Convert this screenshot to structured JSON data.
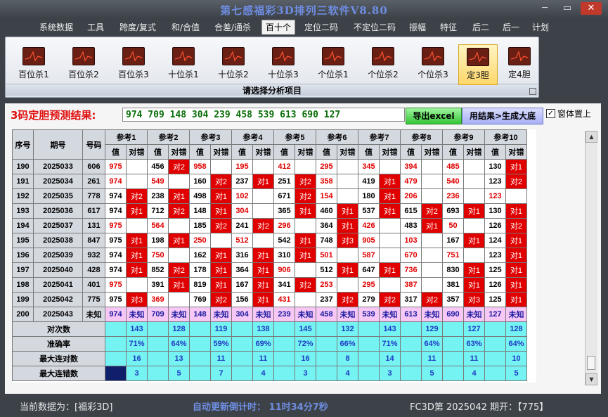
{
  "window": {
    "title": "第七感福彩3D排列三软件V8.80",
    "min": "─",
    "max": "▭",
    "close": "✕"
  },
  "menu": [
    "系统数据",
    "工具",
    "跨度/复式",
    "和/合值",
    "合差/通杀",
    "百十个",
    "定位二码",
    "不定位二码",
    "振幅",
    "特征",
    "后二",
    "后一",
    "计划"
  ],
  "active_menu": "百十个",
  "ribbon": {
    "buttons": [
      "百位杀1",
      "百位杀2",
      "百位杀3",
      "十位杀1",
      "十位杀2",
      "十位杀3",
      "个位杀1",
      "个位杀2",
      "个位杀3",
      "定3胆",
      "定4胆"
    ],
    "selected": "定3胆",
    "caption": "请选择分析项目"
  },
  "prediction": {
    "label": "3码定胆预测结果:",
    "value": "974  709  148  304  239  458  539  613  690  127",
    "export_button": "导出excel",
    "generate_button": "用结果>生成大底",
    "checkbox_checked": "✓",
    "checkbox_label": "窗体置上"
  },
  "table": {
    "headers": {
      "seq": "序号",
      "period": "期号",
      "code": "号码",
      "value": "值",
      "result": "对错"
    },
    "refs": [
      "参考1",
      "参考2",
      "参考3",
      "参考4",
      "参考5",
      "参考6",
      "参考7",
      "参考8",
      "参考9",
      "参考10"
    ],
    "rows": [
      {
        "seq": "190",
        "period": "2025033",
        "code": "606",
        "cells": [
          [
            "975",
            ""
          ],
          [
            "456",
            "对2"
          ],
          [
            "958",
            ""
          ],
          [
            "195",
            ""
          ],
          [
            "412",
            ""
          ],
          [
            "295",
            ""
          ],
          [
            "345",
            ""
          ],
          [
            "394",
            ""
          ],
          [
            "485",
            ""
          ],
          [
            "130",
            "对1"
          ]
        ]
      },
      {
        "seq": "191",
        "period": "2025034",
        "code": "261",
        "cells": [
          [
            "974",
            ""
          ],
          [
            "549",
            ""
          ],
          [
            "160",
            "对2"
          ],
          [
            "237",
            "对1"
          ],
          [
            "251",
            "对2"
          ],
          [
            "358",
            ""
          ],
          [
            "419",
            "对1"
          ],
          [
            "479",
            ""
          ],
          [
            "540",
            ""
          ],
          [
            "123",
            "对2"
          ]
        ]
      },
      {
        "seq": "192",
        "period": "2025035",
        "code": "778",
        "cells": [
          [
            "974",
            "对2"
          ],
          [
            "238",
            "对1"
          ],
          [
            "498",
            "对1"
          ],
          [
            "102",
            ""
          ],
          [
            "671",
            "对2"
          ],
          [
            "154",
            ""
          ],
          [
            "180",
            "对1"
          ],
          [
            "206",
            ""
          ],
          [
            "236",
            ""
          ],
          [
            "123",
            ""
          ]
        ]
      },
      {
        "seq": "193",
        "period": "2025036",
        "code": "617",
        "cells": [
          [
            "974",
            "对1"
          ],
          [
            "712",
            "对2"
          ],
          [
            "148",
            "对1"
          ],
          [
            "304",
            ""
          ],
          [
            "365",
            "对1"
          ],
          [
            "460",
            "对1"
          ],
          [
            "537",
            "对1"
          ],
          [
            "615",
            "对2"
          ],
          [
            "693",
            "对1"
          ],
          [
            "130",
            "对1"
          ]
        ]
      },
      {
        "seq": "194",
        "period": "2025037",
        "code": "131",
        "cells": [
          [
            "975",
            ""
          ],
          [
            "564",
            ""
          ],
          [
            "185",
            "对2"
          ],
          [
            "241",
            "对2"
          ],
          [
            "296",
            ""
          ],
          [
            "364",
            "对1"
          ],
          [
            "426",
            ""
          ],
          [
            "483",
            "对1"
          ],
          [
            "50",
            ""
          ],
          [
            "126",
            "对2"
          ]
        ]
      },
      {
        "seq": "195",
        "period": "2025038",
        "code": "847",
        "cells": [
          [
            "975",
            "对1"
          ],
          [
            "198",
            "对1"
          ],
          [
            "250",
            ""
          ],
          [
            "512",
            ""
          ],
          [
            "542",
            "对1"
          ],
          [
            "748",
            "对3"
          ],
          [
            "905",
            ""
          ],
          [
            "103",
            ""
          ],
          [
            "167",
            "对1"
          ],
          [
            "124",
            "对1"
          ]
        ]
      },
      {
        "seq": "196",
        "period": "2025039",
        "code": "932",
        "cells": [
          [
            "974",
            "对1"
          ],
          [
            "750",
            ""
          ],
          [
            "162",
            "对1"
          ],
          [
            "316",
            "对1"
          ],
          [
            "310",
            "对1"
          ],
          [
            "501",
            ""
          ],
          [
            "587",
            ""
          ],
          [
            "670",
            ""
          ],
          [
            "751",
            ""
          ],
          [
            "123",
            "对1"
          ]
        ]
      },
      {
        "seq": "197",
        "period": "2025040",
        "code": "428",
        "cells": [
          [
            "974",
            "对1"
          ],
          [
            "852",
            "对2"
          ],
          [
            "178",
            "对1"
          ],
          [
            "364",
            "对1"
          ],
          [
            "906",
            ""
          ],
          [
            "512",
            "对1"
          ],
          [
            "647",
            "对1"
          ],
          [
            "736",
            ""
          ],
          [
            "830",
            "对1"
          ],
          [
            "125",
            "对1"
          ]
        ]
      },
      {
        "seq": "198",
        "period": "2025041",
        "code": "401",
        "cells": [
          [
            "975",
            ""
          ],
          [
            "391",
            "对1"
          ],
          [
            "819",
            "对1"
          ],
          [
            "167",
            "对1"
          ],
          [
            "341",
            "对2"
          ],
          [
            "253",
            ""
          ],
          [
            "295",
            ""
          ],
          [
            "387",
            ""
          ],
          [
            "381",
            "对1"
          ],
          [
            "126",
            "对1"
          ]
        ]
      },
      {
        "seq": "199",
        "period": "2025042",
        "code": "775",
        "cells": [
          [
            "975",
            "对3"
          ],
          [
            "369",
            ""
          ],
          [
            "769",
            "对2"
          ],
          [
            "156",
            "对1"
          ],
          [
            "431",
            ""
          ],
          [
            "237",
            "对2"
          ],
          [
            "279",
            "对2"
          ],
          [
            "317",
            "对2"
          ],
          [
            "357",
            "对3"
          ],
          [
            "125",
            "对1"
          ]
        ]
      }
    ],
    "pending_row": {
      "seq": "200",
      "period": "2025043",
      "code": "未知",
      "cells": [
        [
          "974",
          "未知"
        ],
        [
          "709",
          "未知"
        ],
        [
          "148",
          "未知"
        ],
        [
          "304",
          "未知"
        ],
        [
          "239",
          "未知"
        ],
        [
          "458",
          "未知"
        ],
        [
          "539",
          "未知"
        ],
        [
          "613",
          "未知"
        ],
        [
          "690",
          "未知"
        ],
        [
          "127",
          "未知"
        ]
      ]
    },
    "stats": [
      {
        "label": "对次数",
        "values": [
          "143",
          "128",
          "119",
          "138",
          "145",
          "132",
          "143",
          "129",
          "127",
          "128"
        ]
      },
      {
        "label": "准确率",
        "values": [
          "71%",
          "64%",
          "59%",
          "69%",
          "72%",
          "66%",
          "71%",
          "64%",
          "63%",
          "64%"
        ]
      },
      {
        "label": "最大连对数",
        "values": [
          "16",
          "13",
          "11",
          "11",
          "16",
          "8",
          "14",
          "11",
          "11",
          "10"
        ]
      },
      {
        "label": "最大连错数",
        "values": [
          "3",
          "5",
          "7",
          "4",
          "3",
          "4",
          "3",
          "5",
          "4",
          "5"
        ]
      }
    ]
  },
  "status": {
    "current": "当前数据为：[福彩3D]",
    "countdown": "自动更新倒计时：  11时34分7秒",
    "period": "FC3D第 2025042 期开：【775】"
  },
  "colors": {
    "error_red": "#e00000",
    "stat_cyan": "#75f2f2",
    "pending_pink": "#f7c8f5",
    "title_blue": "#6f8de2"
  }
}
